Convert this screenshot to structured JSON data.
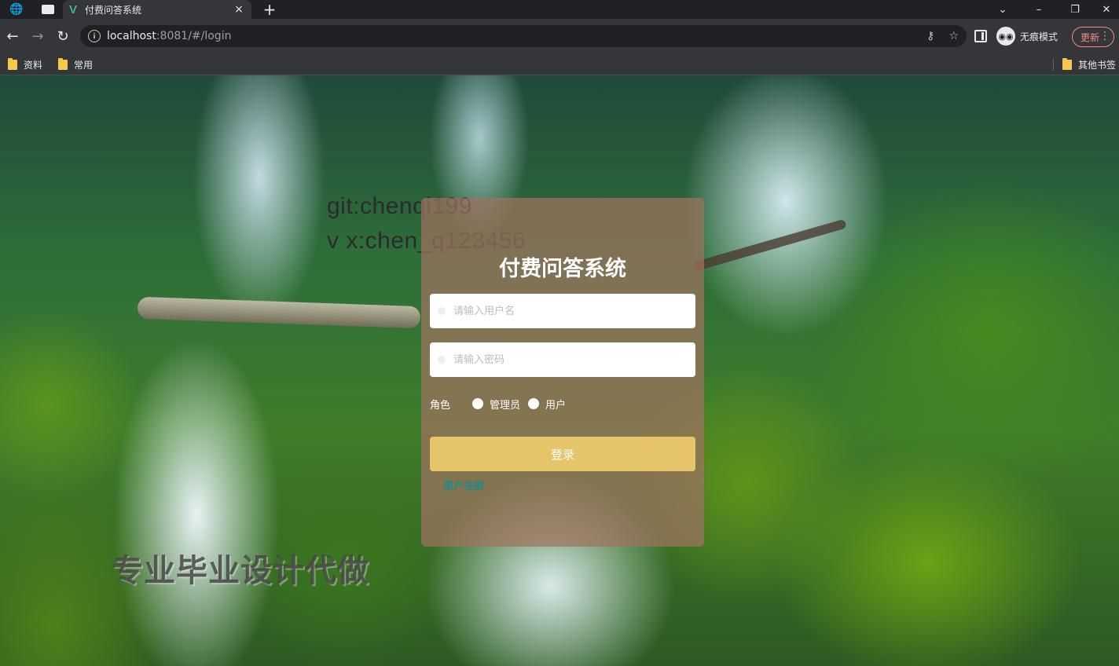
{
  "browser": {
    "tab_title": "付费问答系统",
    "tab_close": "×",
    "new_tab": "+",
    "url_host": "localhost",
    "url_rest": ":8081/#/login",
    "incognito_label": "无痕模式",
    "update_label": "更新",
    "bookmarks": [
      "资料",
      "常用"
    ],
    "other_bookmarks": "其他书签",
    "window_controls": [
      "⌄",
      "–",
      "❐",
      "✕"
    ]
  },
  "page": {
    "overlay_line1": "git:chenqi199",
    "overlay_line2": "v x:chen_q123456",
    "watermark": "专业毕业设计代做"
  },
  "login": {
    "title": "付费问答系统",
    "username_placeholder": "请输入用户名",
    "password_placeholder": "请输入密码",
    "role_label": "角色",
    "role_options": [
      "管理员",
      "用户"
    ],
    "login_button": "登录",
    "register_link": "用户注册"
  },
  "colors": {
    "card_bg": "#a0735f",
    "login_button": "#e6c469",
    "register_link": "#1f8a8a"
  }
}
